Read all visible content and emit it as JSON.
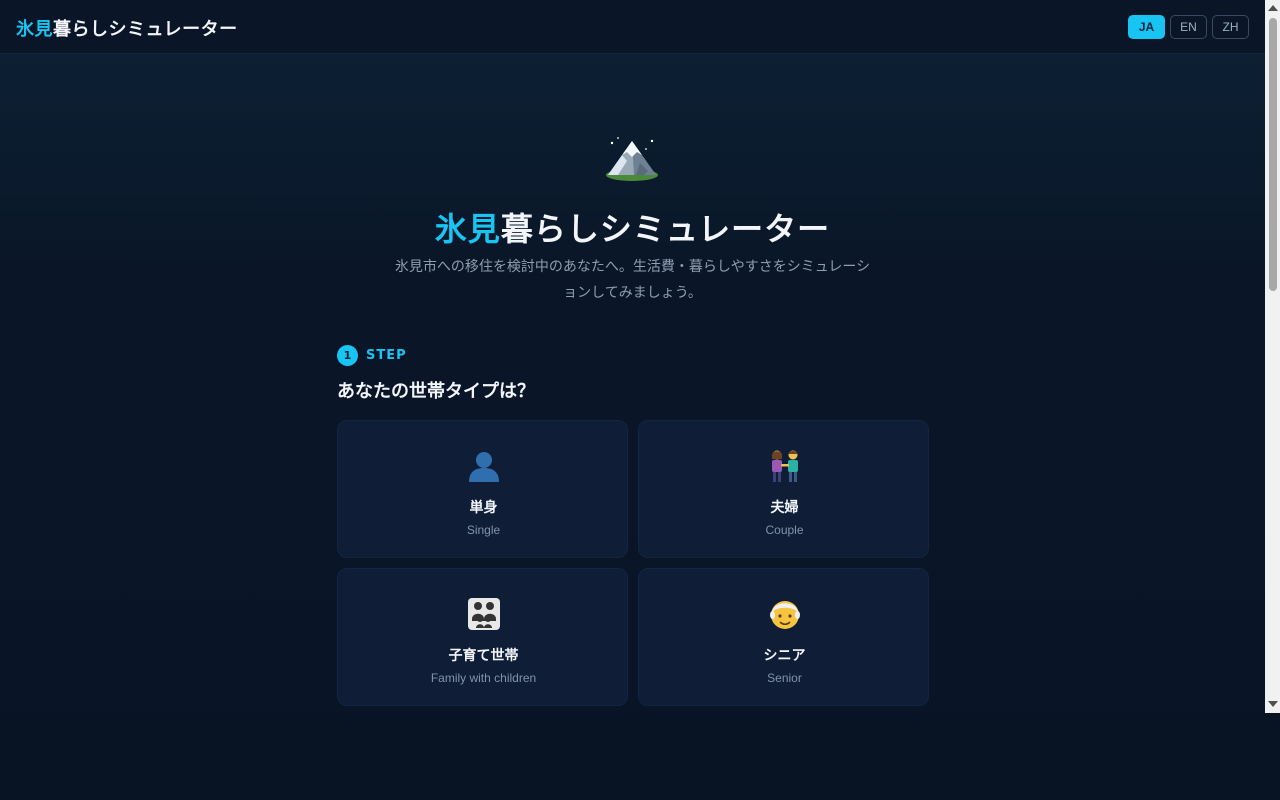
{
  "header": {
    "brand_accent": "氷見",
    "brand_rest": "暮らしシミュレーター",
    "languages": [
      {
        "label": "JA",
        "active": true
      },
      {
        "label": "EN",
        "active": false
      },
      {
        "label": "ZH",
        "active": false
      }
    ]
  },
  "hero": {
    "icon": "snow-mountain-icon",
    "title_accent": "氷見",
    "title_rest": "暮らしシミュレーター",
    "subtitle": "氷見市への移住を検討中のあなたへ。生活費・暮らしやすさをシミュレーションしてみましょう。"
  },
  "step": {
    "number": "1",
    "label": "STEP",
    "question": "あなたの世帯タイプは？"
  },
  "options": [
    {
      "icon": "person-silhouette-icon",
      "title": "単身",
      "subtitle": "Single"
    },
    {
      "icon": "couple-icon",
      "title": "夫婦",
      "subtitle": "Couple"
    },
    {
      "icon": "family-icon",
      "title": "子育て世帯",
      "subtitle": "Family with children"
    },
    {
      "icon": "senior-icon",
      "title": "シニア",
      "subtitle": "Senior"
    }
  ],
  "colors": {
    "accent": "#18c4f2",
    "background": "#0a1628",
    "card": "#0f1e36"
  }
}
